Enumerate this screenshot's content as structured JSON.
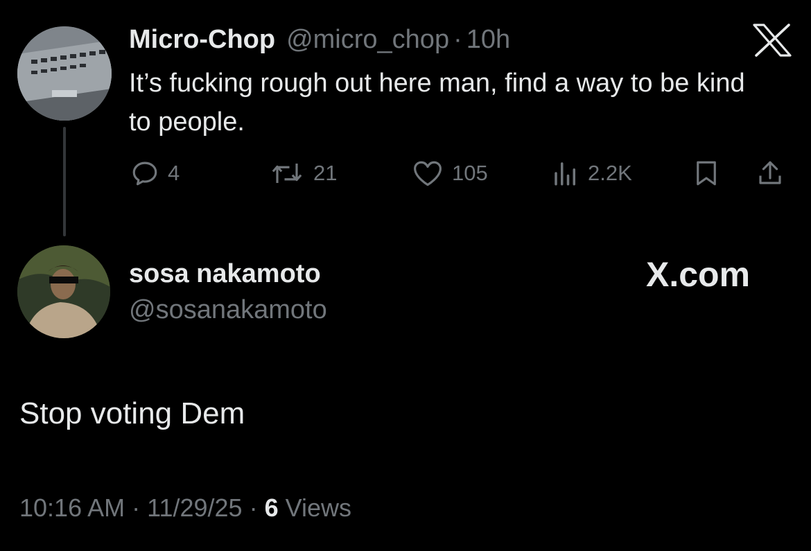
{
  "original_tweet": {
    "author_name": "Micro-Chop",
    "author_handle": "@micro_chop",
    "time_separator": "·",
    "time_ago": "10h",
    "text": "It’s fucking rough out here man, find a way to be kind to people.",
    "actions": {
      "replies": "4",
      "reposts": "21",
      "likes": "105",
      "views": "2.2K"
    }
  },
  "reply": {
    "author_name": "sosa nakamoto",
    "author_handle": "@sosanakamoto",
    "text": "Stop voting Dem",
    "timestamp_time": "10:16 AM",
    "meta_separator": "·",
    "timestamp_date": "11/29/25",
    "views_count": "6",
    "views_label": "Views"
  },
  "branding": {
    "site_label": "X.com"
  },
  "icons": {
    "top_logo": "x-logo-icon",
    "reply": "reply-icon",
    "repost": "repost-icon",
    "like": "heart-icon",
    "views": "views-icon",
    "bookmark": "bookmark-icon",
    "share": "share-icon"
  },
  "colors": {
    "background": "#000000",
    "primary_text": "#e7e9ea",
    "secondary_text": "#71767b",
    "thread_line": "#333639"
  }
}
